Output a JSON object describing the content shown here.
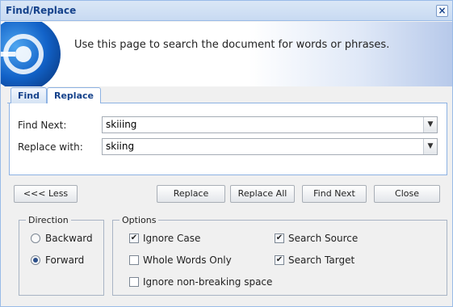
{
  "window": {
    "title": "Find/Replace",
    "close_icon": "×"
  },
  "banner": {
    "text": "Use this page to search the document for words or phrases."
  },
  "tabs": [
    {
      "label": "Find",
      "active": false
    },
    {
      "label": "Replace",
      "active": true
    }
  ],
  "fields": {
    "find_next": {
      "label": "Find Next:",
      "value": "skiiing"
    },
    "replace_with": {
      "label": "Replace with:",
      "value": "skiing"
    }
  },
  "buttons": {
    "less": "<<< Less",
    "replace": "Replace",
    "replace_all": "Replace All",
    "find_next": "Find Next",
    "close": "Close"
  },
  "direction": {
    "legend": "Direction",
    "backward": {
      "label": "Backward",
      "checked": false
    },
    "forward": {
      "label": "Forward",
      "checked": true
    }
  },
  "options": {
    "legend": "Options",
    "ignore_case": {
      "label": "Ignore Case",
      "checked": true
    },
    "whole_words_only": {
      "label": "Whole Words Only",
      "checked": false
    },
    "ignore_nbsp": {
      "label": "Ignore non-breaking space",
      "checked": false
    },
    "search_source": {
      "label": "Search Source",
      "checked": true
    },
    "search_target": {
      "label": "Search Target",
      "checked": true
    }
  },
  "colors": {
    "accent": "#15428b",
    "border": "#99bbe8"
  }
}
